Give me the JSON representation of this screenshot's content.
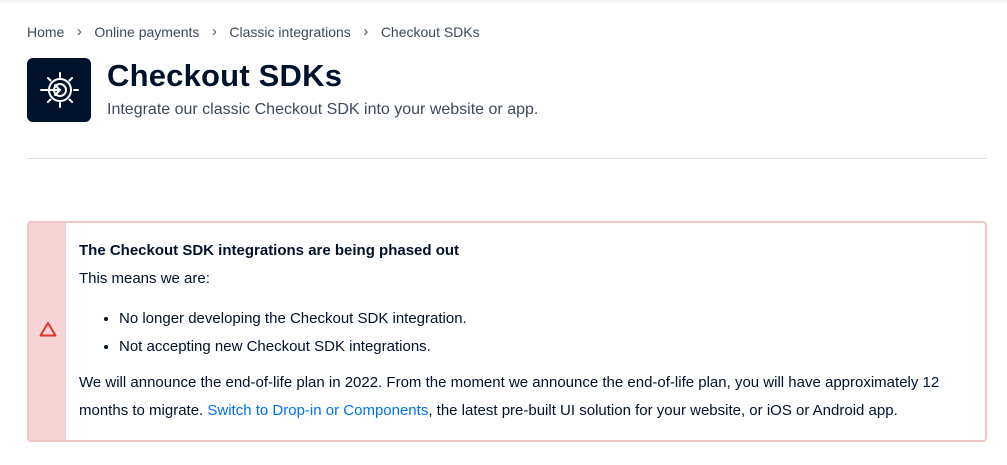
{
  "breadcrumb": {
    "items": [
      "Home",
      "Online payments",
      "Classic integrations",
      "Checkout SDKs"
    ],
    "separator": "›"
  },
  "header": {
    "icon": "target-arrow-icon",
    "title": "Checkout SDKs",
    "subtitle": "Integrate our classic Checkout SDK into your website or app."
  },
  "alert": {
    "icon": "warning-triangle-icon",
    "accent_color": "#e0312d",
    "title": "The Checkout SDK integrations are being phased out",
    "intro": "This means we are:",
    "list": [
      "No longer developing the Checkout SDK integration.",
      "Not accepting new Checkout SDK integrations."
    ],
    "text_before_link": "We will announce the end-of-life plan in 2022. From the moment we announce the end-of-life plan, you will have approximately 12 months to migrate. ",
    "link_text": "Switch to Drop-in or Components",
    "text_after_link": ", the latest pre-built UI solution for your website, or iOS or Android app."
  }
}
